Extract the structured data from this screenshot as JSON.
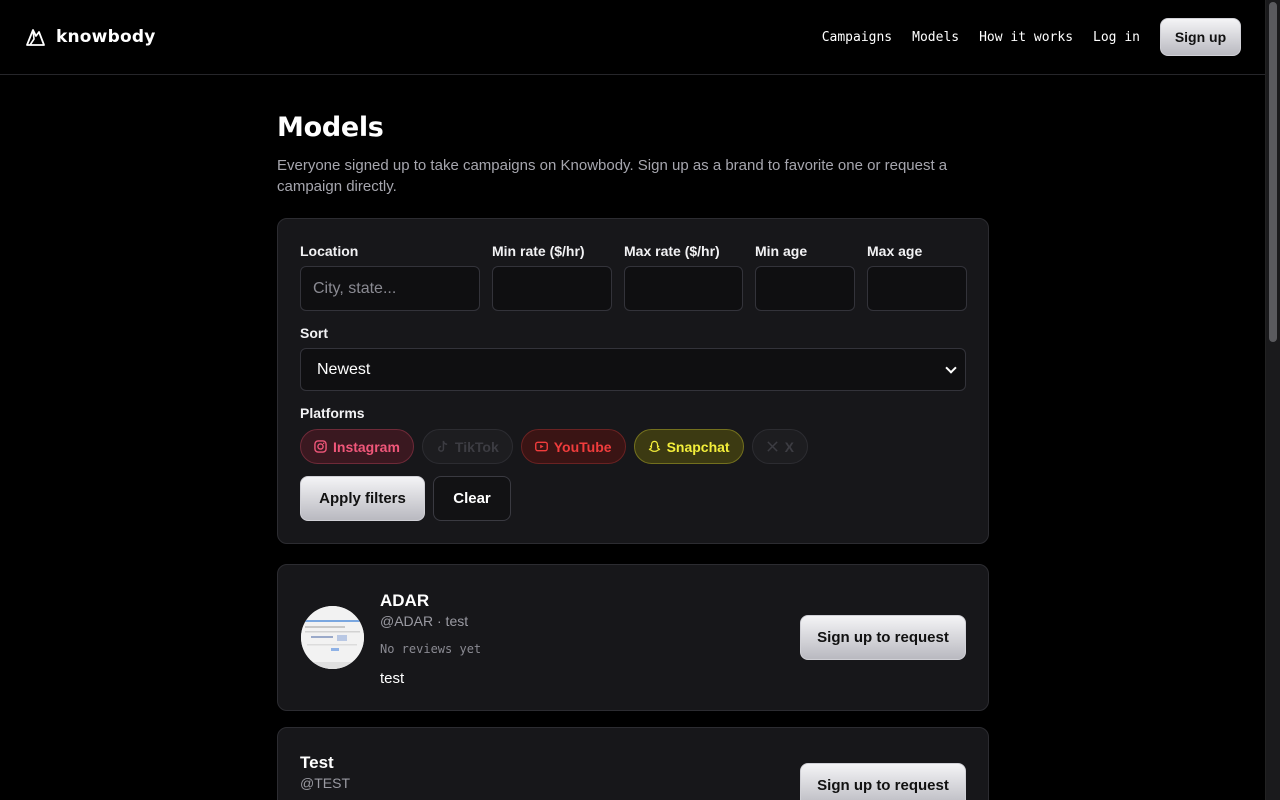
{
  "header": {
    "brand": "knowbody",
    "nav": [
      "Campaigns",
      "Models",
      "How it works",
      "Log in"
    ],
    "signup_label": "Sign up"
  },
  "page": {
    "title": "Models",
    "subtitle": "Everyone signed up to take campaigns on Knowbody. Sign up as a brand to favorite one or request a campaign directly."
  },
  "filters": {
    "location_label": "Location",
    "location_placeholder": "City, state...",
    "min_rate_label": "Min rate ($/hr)",
    "max_rate_label": "Max rate ($/hr)",
    "min_age_label": "Min age",
    "max_age_label": "Max age",
    "sort_label": "Sort",
    "sort_value": "Newest",
    "platforms_label": "Platforms",
    "platforms": [
      {
        "label": "Instagram",
        "icon": "instagram-icon",
        "active": true,
        "color": "#f0577a"
      },
      {
        "label": "TikTok",
        "icon": "tiktok-icon",
        "active": false
      },
      {
        "label": "YouTube",
        "icon": "youtube-icon",
        "active": true,
        "color": "#f03c3c"
      },
      {
        "label": "Snapchat",
        "icon": "snapchat-icon",
        "active": true,
        "color": "#f3ee3a"
      },
      {
        "label": "X",
        "icon": "x-icon",
        "active": false
      }
    ],
    "apply_label": "Apply filters",
    "clear_label": "Clear"
  },
  "models": [
    {
      "name": "ADAR",
      "handle": "@ADAR · test",
      "reviews": "No reviews yet",
      "bio": "test",
      "cta": "Sign up to request"
    },
    {
      "name": "Test",
      "handle": "@TEST",
      "cta": "Sign up to request"
    }
  ]
}
